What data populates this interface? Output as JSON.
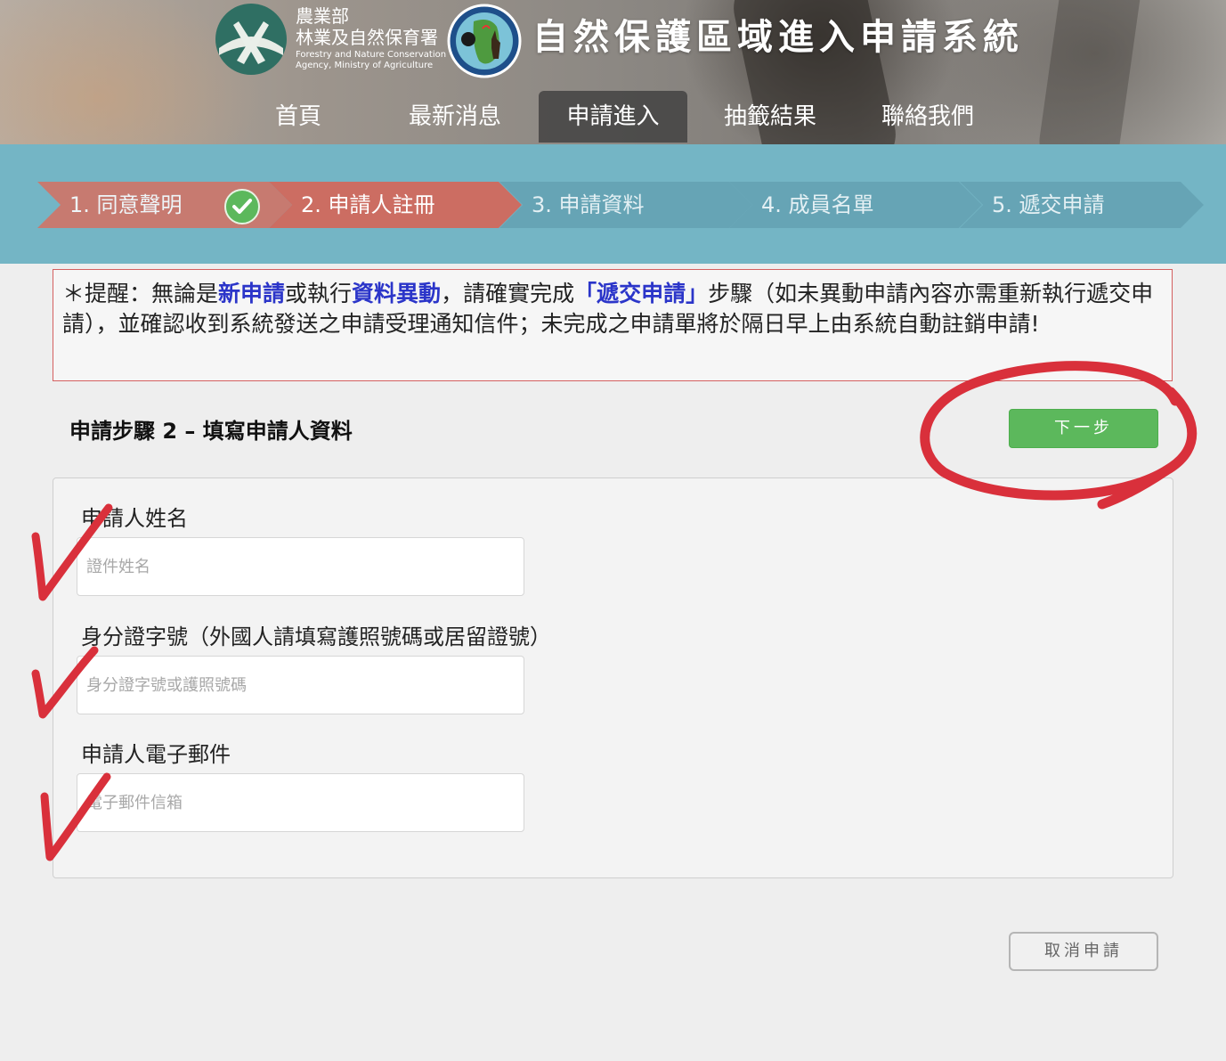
{
  "header": {
    "agency_name_zh_line1": "農業部",
    "agency_name_zh_line2": "林業及自然保育署",
    "agency_name_en_line1": "Forestry and Nature Conservation",
    "agency_name_en_line2": "Agency, Ministry of Agriculture",
    "site_title": "自然保護區域進入申請系統"
  },
  "nav": {
    "items": [
      {
        "label": "首頁"
      },
      {
        "label": "最新消息"
      },
      {
        "label": "申請進入"
      },
      {
        "label": "抽籤結果"
      },
      {
        "label": "聯絡我們"
      }
    ],
    "active_label": "申請進入"
  },
  "steps": [
    {
      "label": "1. 同意聲明",
      "status": "done"
    },
    {
      "label": "2. 申請人註冊",
      "status": "current"
    },
    {
      "label": "3. 申請資料",
      "status": "todo"
    },
    {
      "label": "4. 成員名單",
      "status": "todo"
    },
    {
      "label": "5. 遞交申請",
      "status": "todo"
    }
  ],
  "notice": {
    "prefix": "＊提醒：無論是",
    "highlight1": "新申請",
    "mid1": "或執行",
    "highlight2": "資料異動",
    "mid2": "，請確實完成",
    "highlight3": "「遞交申請」",
    "rest": "步驟（如未異動申請內容亦需重新執行遞交申請），並確認收到系統發送之申請受理通知信件；未完成之申請單將於隔日早上由系統自動註銷申請!"
  },
  "form": {
    "section_title": "申請步驟 2 – 填寫申請人資料",
    "next_label": "下一步",
    "cancel_label": "取消申請",
    "fields": [
      {
        "label": "申請人姓名",
        "placeholder": "證件姓名",
        "value": ""
      },
      {
        "label": "身分證字號（外國人請填寫護照號碼或居留證號）",
        "placeholder": "身分證字號或護照號碼",
        "value": ""
      },
      {
        "label": "申請人電子郵件",
        "placeholder": "電子郵件信箱",
        "value": ""
      }
    ]
  },
  "colors": {
    "step_bar_bg": "#74b5c5",
    "step_done": "#c77a70",
    "step_current": "#cc6d62",
    "step_todo": "#66a4b5",
    "notice_border": "#d46060",
    "notice_highlight": "#2b35c9",
    "next_button": "#5cb85c",
    "annotation_red": "#d9303b"
  },
  "icons": {
    "step1_status": "check-circle-icon",
    "agency_logo": "agency-logo-icon",
    "emblem": "wildlife-emblem-icon"
  }
}
